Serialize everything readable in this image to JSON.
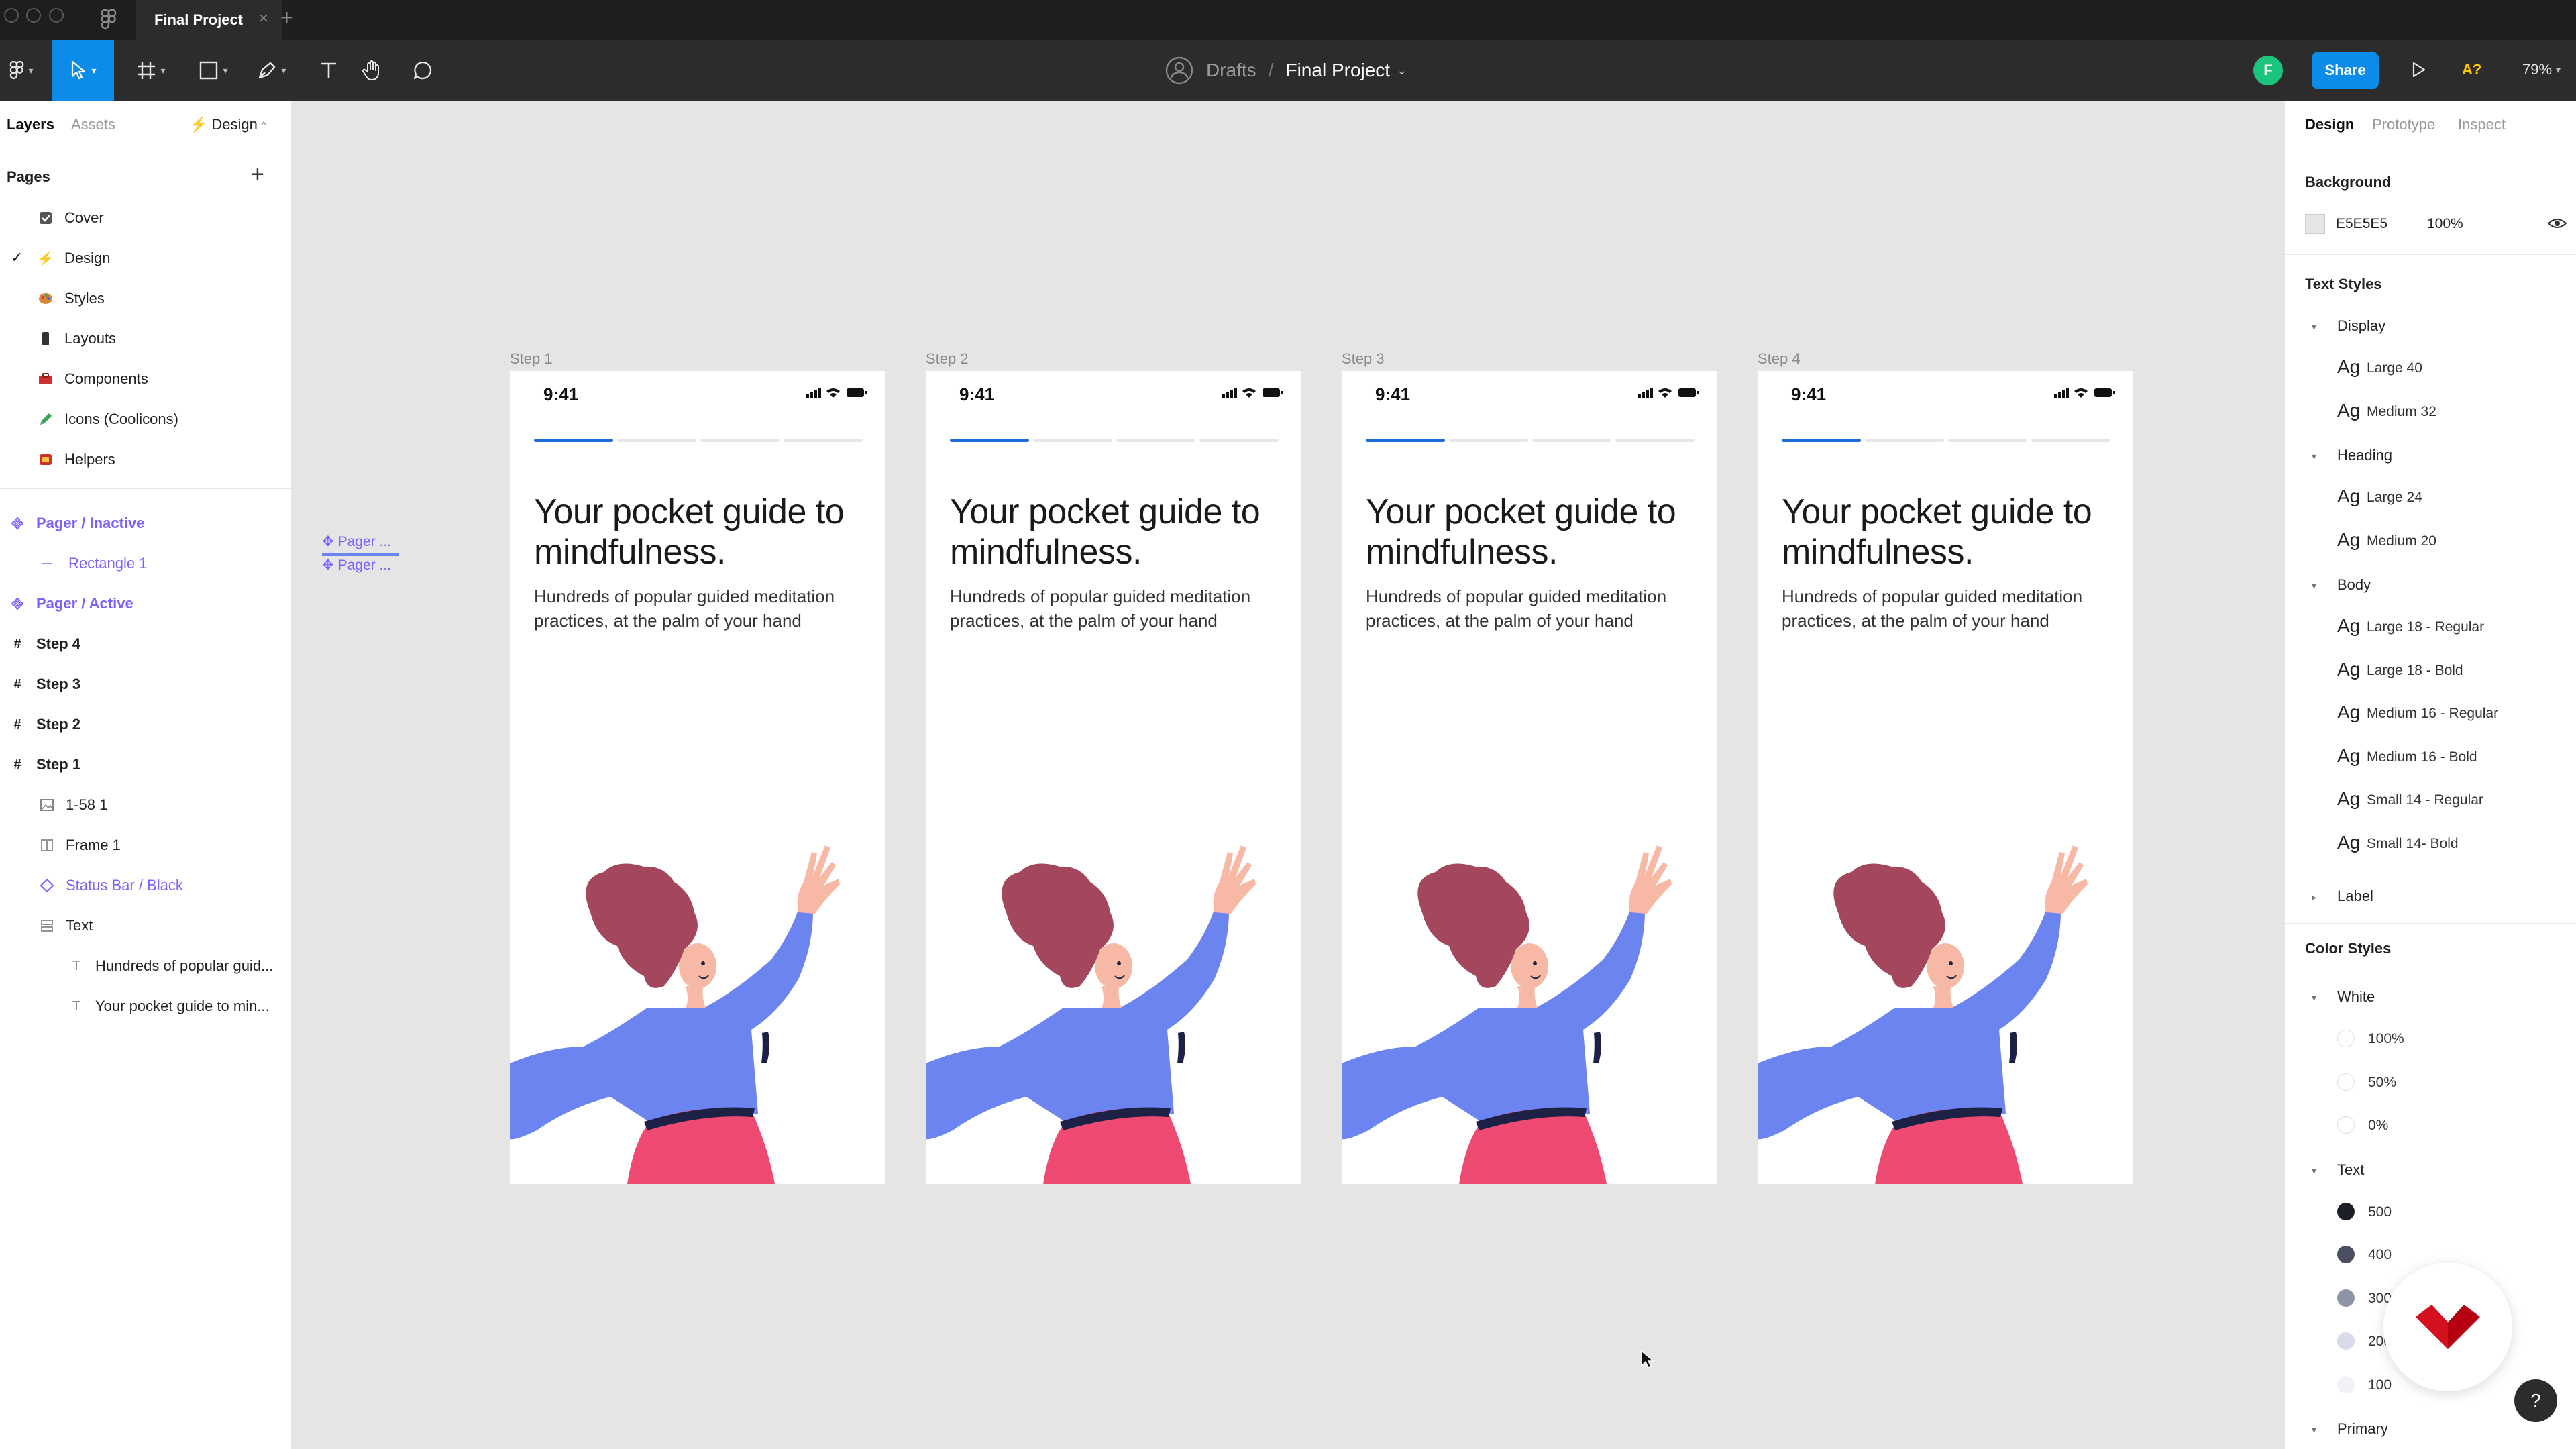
{
  "window": {
    "tab_title": "Final Project",
    "add_tab": "+",
    "close_tab": "×"
  },
  "toolbar": {
    "breadcrumb_drafts": "Drafts",
    "breadcrumb_sep": "/",
    "project_name": "Final Project",
    "avatar_initial": "F",
    "share_label": "Share",
    "a11y_label": "A?",
    "zoom": "79%"
  },
  "left_panel": {
    "tabs": [
      "Layers",
      "Assets"
    ],
    "page_switch": "Design",
    "pages_title": "Pages",
    "add_page": "+",
    "pages": [
      {
        "label": "Cover",
        "icon": "cover-icon"
      },
      {
        "label": "Design",
        "icon": "lightning-icon",
        "active": true
      },
      {
        "label": "Styles",
        "icon": "palette-icon"
      },
      {
        "label": "Layouts",
        "icon": "phone-icon"
      },
      {
        "label": "Components",
        "icon": "toolbox-icon"
      },
      {
        "label": "Icons (Coolicons)",
        "icon": "pencil-icon"
      },
      {
        "label": "Helpers",
        "icon": "helpers-icon"
      }
    ],
    "layers": [
      {
        "label": "Pager / Inactive",
        "kind": "component"
      },
      {
        "label": "Rectangle 1",
        "kind": "component-child"
      },
      {
        "label": "Pager / Active",
        "kind": "component"
      },
      {
        "label": "Step 4",
        "kind": "frame"
      },
      {
        "label": "Step 3",
        "kind": "frame"
      },
      {
        "label": "Step 2",
        "kind": "frame"
      },
      {
        "label": "Step 1",
        "kind": "frame"
      },
      {
        "label": "1-58 1",
        "kind": "image"
      },
      {
        "label": "Frame 1",
        "kind": "frame-child"
      },
      {
        "label": "Status Bar / Black",
        "kind": "instance"
      },
      {
        "label": "Text",
        "kind": "group"
      },
      {
        "label": "Hundreds of popular guid...",
        "kind": "text"
      },
      {
        "label": "Your pocket guide to min...",
        "kind": "text"
      }
    ]
  },
  "canvas": {
    "floating_pagers": [
      "Pager ...",
      "Pager ..."
    ],
    "frames": [
      {
        "label": "Step 1",
        "time": "9:41",
        "headline": "Your pocket guide to mindfulness.",
        "body": "Hundreds of popular guided meditation practices, at the palm of your hand"
      },
      {
        "label": "Step 2",
        "time": "9:41",
        "headline": "Your pocket guide to mindfulness.",
        "body": "Hundreds of popular guided meditation practices, at the palm of your hand"
      },
      {
        "label": "Step 3",
        "time": "9:41",
        "headline": "Your pocket guide to mindfulness.",
        "body": "Hundreds of popular guided meditation practices, at the palm of your hand"
      },
      {
        "label": "Step 4",
        "time": "9:41",
        "headline": "Your pocket guide to mindfulness.",
        "body": "Hundreds of popular guided meditation practices, at the palm of your hand"
      }
    ],
    "colors": {
      "pager_active": "#1C6EDB",
      "pager_inactive": "#E4E6EB",
      "shirt": "#6B84F0",
      "skirt": "#EE4A72",
      "hair": "#A4475C",
      "skin": "#F7B9A6"
    }
  },
  "right_panel": {
    "tabs": [
      "Design",
      "Prototype",
      "Inspect"
    ],
    "background_title": "Background",
    "background_hex": "E5E5E5",
    "background_opacity": "100%",
    "text_styles_title": "Text Styles",
    "text_groups": [
      {
        "name": "Display",
        "styles": [
          "Large 40",
          "Medium 32"
        ]
      },
      {
        "name": "Heading",
        "styles": [
          "Large 24",
          "Medium 20"
        ]
      },
      {
        "name": "Body",
        "styles": [
          "Large 18 - Regular",
          "Large 18 - Bold",
          "Medium 16 - Regular",
          "Medium 16 - Bold",
          "Small 14 - Regular",
          "Small 14- Bold"
        ]
      }
    ],
    "label_group": "Label",
    "ag": "Ag",
    "color_styles_title": "Color Styles",
    "white_group": "White",
    "white_items": [
      "100%",
      "50%",
      "0%"
    ],
    "text_group": "Text",
    "text_items": [
      {
        "label": "500",
        "color": "#1D1F26"
      },
      {
        "label": "400",
        "color": "#4B5060"
      },
      {
        "label": "300",
        "color": "#8E94A8"
      },
      {
        "label": "200",
        "color": "#D8DCEA"
      },
      {
        "label": "100",
        "color": "#F1F2F6"
      }
    ],
    "primary_group": "Primary"
  },
  "help_label": "?"
}
